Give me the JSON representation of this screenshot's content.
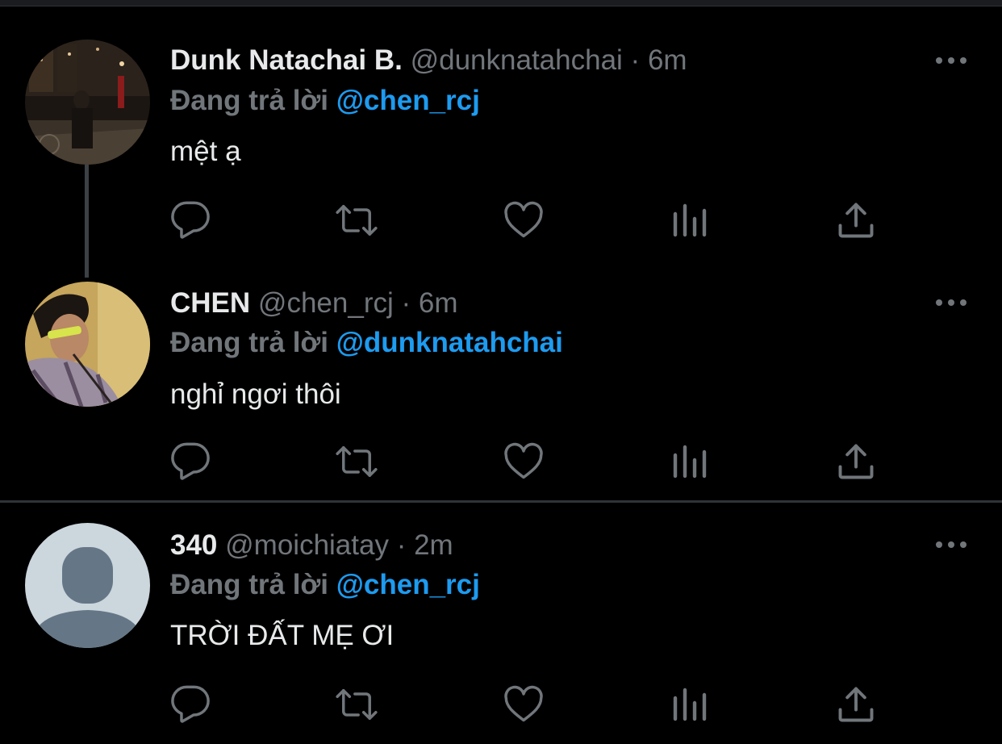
{
  "tweets": [
    {
      "name": "Dunk Natachai B.",
      "handle": "@dunknatahchai",
      "separator": "·",
      "time": "6m",
      "reply_label": "Đang trả lời",
      "reply_to": "@chen_rcj",
      "text": "mệt ạ",
      "avatar": "photo-night-street"
    },
    {
      "name": "CHEN",
      "handle": "@chen_rcj",
      "separator": "·",
      "time": "6m",
      "reply_label": "Đang trả lời",
      "reply_to": "@dunknatahchai",
      "text": "nghỉ ngơi thôi",
      "avatar": "photo-person-sunglasses"
    },
    {
      "name": "340",
      "handle": "@moichiatay",
      "separator": "·",
      "time": "2m",
      "reply_label": "Đang trả lời",
      "reply_to": "@chen_rcj",
      "text": "TRỜI ĐẤT MẸ ƠI",
      "avatar": "default-avatar"
    }
  ],
  "actions": [
    "reply-icon",
    "retweet-icon",
    "like-icon",
    "analytics-icon",
    "share-icon"
  ],
  "colors": {
    "background": "#000000",
    "text": "#e7e9ea",
    "secondary": "#71767b",
    "link": "#1d9bf0",
    "divider": "#2f3336"
  }
}
